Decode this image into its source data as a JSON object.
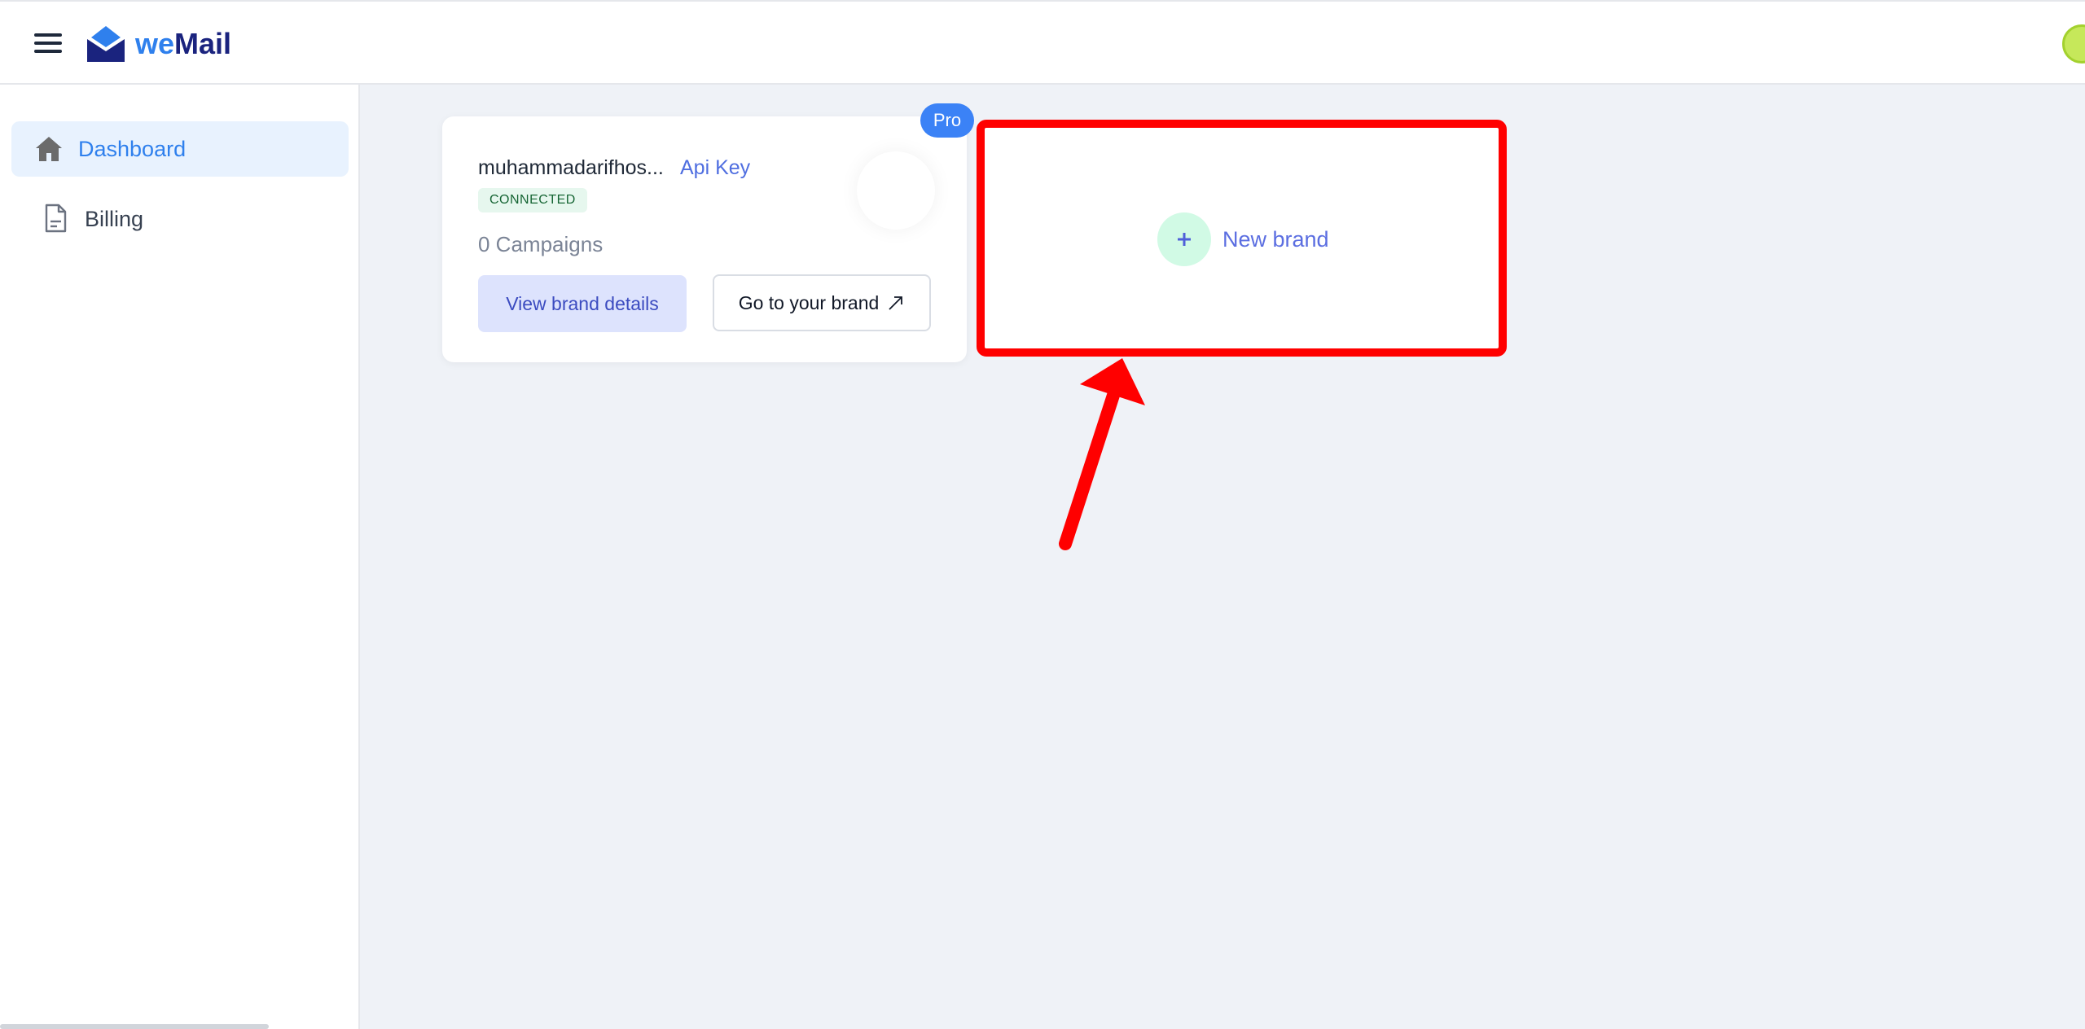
{
  "app": {
    "logo_we": "we",
    "logo_mail": "Mail"
  },
  "sidebar": {
    "items": [
      {
        "label": "Dashboard",
        "icon": "home-icon",
        "active": true
      },
      {
        "label": "Billing",
        "icon": "document-icon",
        "active": false
      }
    ]
  },
  "brand_card": {
    "badge": "Pro",
    "name": "muhammadarifhos...",
    "api_key_label": "Api Key",
    "status": "CONNECTED",
    "campaigns": "0 Campaigns",
    "view_details_label": "View brand details",
    "go_to_brand_label": "Go to your brand",
    "go_to_brand_icon": "external-arrow-icon"
  },
  "new_brand": {
    "label": "New brand",
    "icon": "plus-icon",
    "highlight_color": "#ff0000"
  },
  "colors": {
    "accent": "#2f80ed",
    "brand_dark": "#1a237e",
    "annotation": "#ff0000"
  }
}
